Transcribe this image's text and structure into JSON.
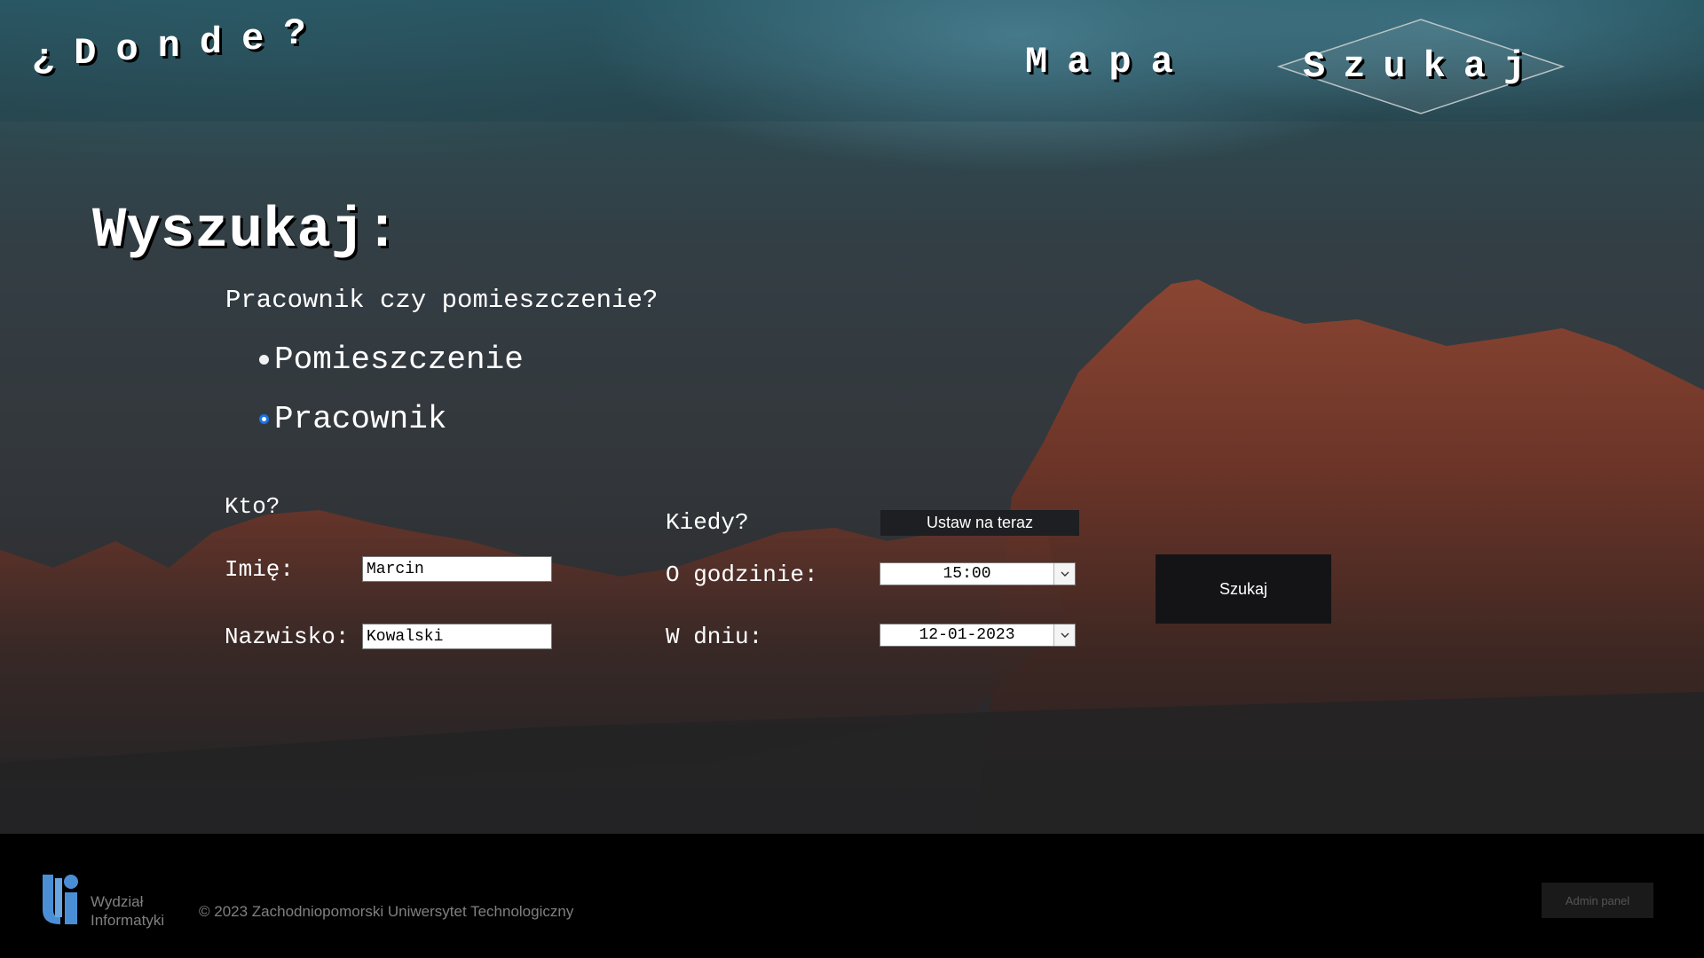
{
  "header": {
    "logo_chars": [
      "¿",
      "D",
      "o",
      "n",
      "d",
      "e",
      "?"
    ],
    "nav_mapa": "Mapa",
    "nav_szukaj": "Szukaj"
  },
  "main": {
    "title": "Wyszukaj:",
    "question": "Pracownik czy pomieszczenie?",
    "options": [
      {
        "label": "Pomieszczenie",
        "selected": false
      },
      {
        "label": "Pracownik",
        "selected": true
      }
    ],
    "who_label": "Kto?",
    "first_name_label": "Imię:",
    "first_name_value": "Marcin",
    "last_name_label": "Nazwisko:",
    "last_name_value": "Kowalski",
    "when_label": "Kiedy?",
    "set_now_button": "Ustaw na teraz",
    "time_label": "O godzinie:",
    "time_value": "15:00",
    "date_label": "W dniu:",
    "date_value": "12-01-2023",
    "search_button": "Szukaj"
  },
  "footer": {
    "logo_line1": "Wydział",
    "logo_line2": "Informatyki",
    "copyright": "© 2023 Zachodniopomorski Uniwersytet Technologiczny",
    "admin_button": "Admin panel"
  },
  "colors": {
    "sky": "#2e5d69",
    "rock": "#7a3e2f",
    "footer_bg": "#000000",
    "logo_blue": "#4a8fd6",
    "radio_selected": "#1a73e8"
  }
}
